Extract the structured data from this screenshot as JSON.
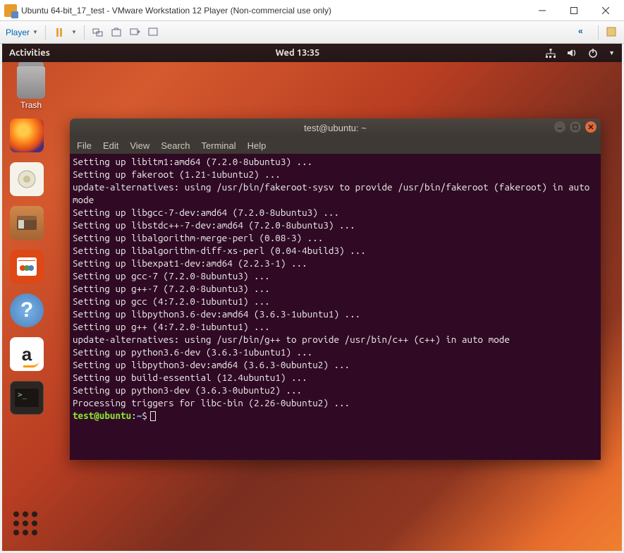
{
  "vmware": {
    "title": "Ubuntu 64-bit_17_test - VMware Workstation 12 Player (Non-commercial use only)",
    "player_label": "Player"
  },
  "ubuntu": {
    "activities": "Activities",
    "clock": "Wed 13:35",
    "trash_label": "Trash"
  },
  "terminal": {
    "title": "test@ubuntu: ~",
    "menu": {
      "file": "File",
      "edit": "Edit",
      "view": "View",
      "search": "Search",
      "terminal": "Terminal",
      "help": "Help"
    },
    "lines": [
      "Setting up libitm1:amd64 (7.2.0-8ubuntu3) ...",
      "Setting up fakeroot (1.21-1ubuntu2) ...",
      "update-alternatives: using /usr/bin/fakeroot-sysv to provide /usr/bin/fakeroot (fakeroot) in auto mode",
      "Setting up libgcc-7-dev:amd64 (7.2.0-8ubuntu3) ...",
      "Setting up libstdc++-7-dev:amd64 (7.2.0-8ubuntu3) ...",
      "Setting up libalgorithm-merge-perl (0.08-3) ...",
      "Setting up libalgorithm-diff-xs-perl (0.04-4build3) ...",
      "Setting up libexpat1-dev:amd64 (2.2.3-1) ...",
      "Setting up gcc-7 (7.2.0-8ubuntu3) ...",
      "Setting up g++-7 (7.2.0-8ubuntu3) ...",
      "Setting up gcc (4:7.2.0-1ubuntu1) ...",
      "Setting up libpython3.6-dev:amd64 (3.6.3-1ubuntu1) ...",
      "Setting up g++ (4:7.2.0-1ubuntu1) ...",
      "update-alternatives: using /usr/bin/g++ to provide /usr/bin/c++ (c++) in auto mode",
      "Setting up python3.6-dev (3.6.3-1ubuntu1) ...",
      "Setting up libpython3-dev:amd64 (3.6.3-0ubuntu2) ...",
      "Setting up build-essential (12.4ubuntu1) ...",
      "Setting up python3-dev (3.6.3-0ubuntu2) ...",
      "Processing triggers for libc-bin (2.26-0ubuntu2) ..."
    ],
    "prompt_user": "test@ubuntu",
    "prompt_sep": ":",
    "prompt_path": "~",
    "prompt_suffix": "$"
  }
}
